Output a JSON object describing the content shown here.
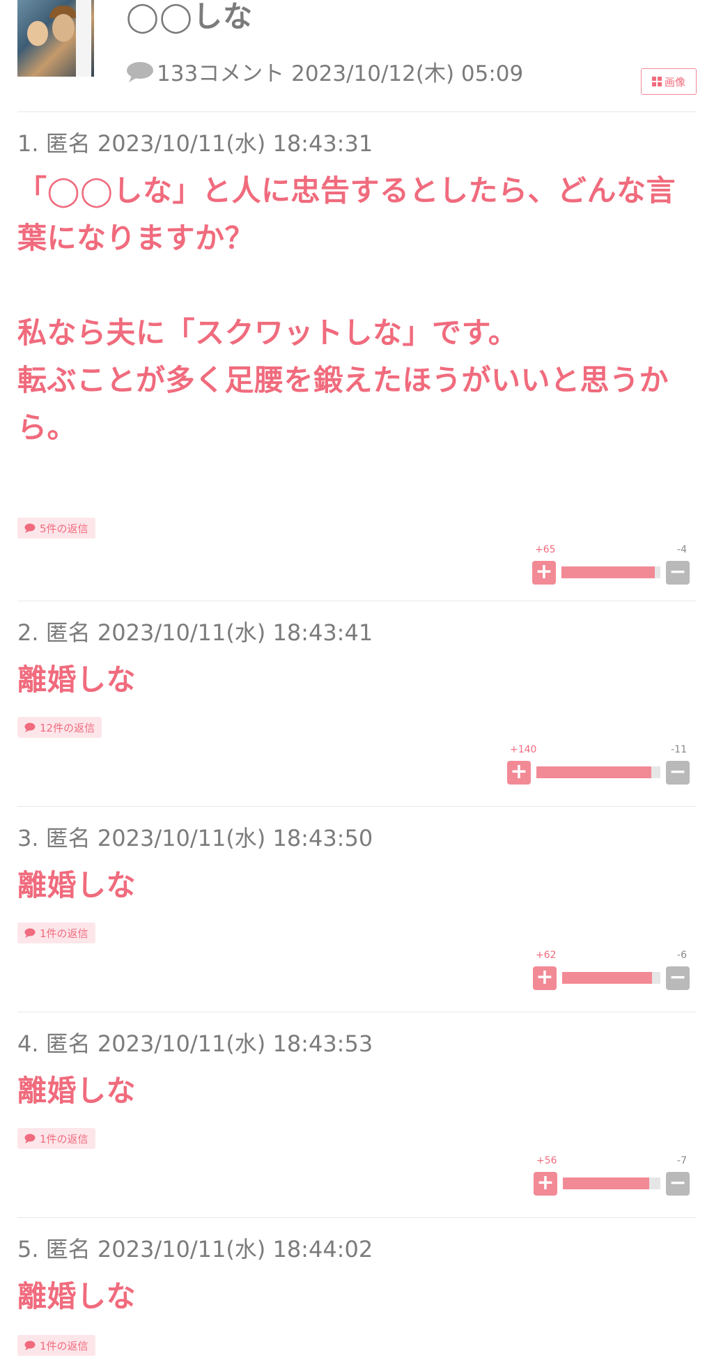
{
  "topic": {
    "title": "◯◯しな",
    "comment_count": "133コメント",
    "posted": "2023/10/12(木) 05:09",
    "image_button": "画像",
    "image_icon": "grid-icon",
    "comment_icon": "speech-bubble-icon"
  },
  "colors": {
    "accent": "#f06b7d",
    "bar_fill": "#f28a96",
    "meta_text": "#7b7b7b"
  },
  "comments": [
    {
      "meta": "1. 匿名 2023/10/11(水) 18:43:31",
      "body": "「◯◯しな」と人に忠告するとしたら、どんな言葉になりますか？\n\n私なら夫に「スクワットしな」です。\n転ぶことが多く足腰を鍛えたほうがいいと思うから。",
      "replies": "5件の返信",
      "plus": "+65",
      "minus": "-4",
      "plus_ratio": 0.942
    },
    {
      "meta": "2. 匿名 2023/10/11(水) 18:43:41",
      "body": "離婚しな",
      "replies": "12件の返信",
      "plus": "+140",
      "minus": "-11",
      "plus_ratio": 0.927
    },
    {
      "meta": "3. 匿名 2023/10/11(水) 18:43:50",
      "body": "離婚しな",
      "replies": "1件の返信",
      "plus": "+62",
      "minus": "-6",
      "plus_ratio": 0.912
    },
    {
      "meta": "4. 匿名 2023/10/11(水) 18:43:53",
      "body": "離婚しな",
      "replies": "1件の返信",
      "plus": "+56",
      "minus": "-7",
      "plus_ratio": 0.889
    },
    {
      "meta": "5. 匿名 2023/10/11(水) 18:44:02",
      "body": "離婚しな",
      "replies": "1件の返信"
    }
  ]
}
